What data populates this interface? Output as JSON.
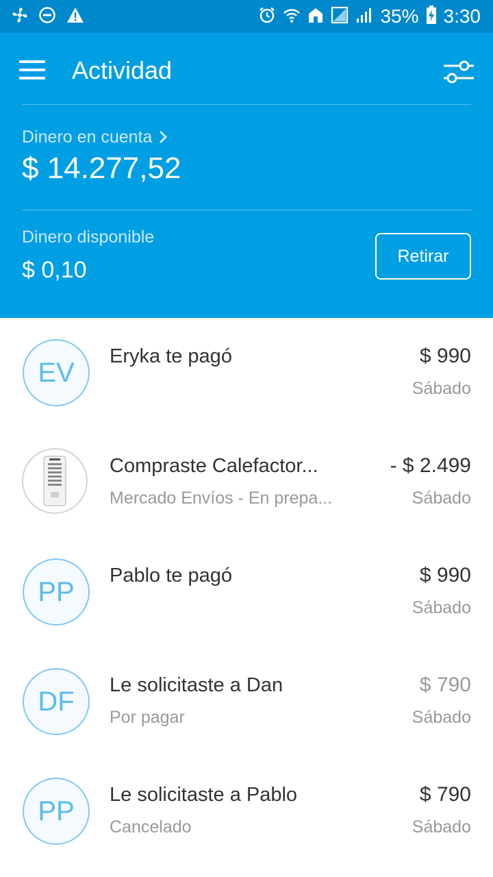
{
  "status_bar": {
    "battery": "35%",
    "time": "3:30"
  },
  "header": {
    "title": "Actividad",
    "balance_label": "Dinero en cuenta",
    "balance_amount": "$ 14.277,52",
    "available_label": "Dinero disponible",
    "available_amount": "$ 0,10",
    "withdraw_label": "Retirar"
  },
  "activities": [
    {
      "initials": "EV",
      "title": "Eryka te pagó",
      "subtitle": "",
      "amount": "$ 990",
      "date": "Sábado"
    },
    {
      "initials": "",
      "title": "Compraste Calefactor...",
      "subtitle": "Mercado Envíos - En prepa...",
      "amount": "- $ 2.499",
      "date": "Sábado"
    },
    {
      "initials": "PP",
      "title": "Pablo te pagó",
      "subtitle": "",
      "amount": "$ 990",
      "date": "Sábado"
    },
    {
      "initials": "DF",
      "title": "Le solicitaste a Dan",
      "subtitle": "Por pagar",
      "amount": "$ 790",
      "date": "Sábado"
    },
    {
      "initials": "PP",
      "title": "Le solicitaste a Pablo",
      "subtitle": "Cancelado",
      "amount": "$ 790",
      "date": "Sábado"
    }
  ],
  "colors": {
    "header_bg": "#009ee3",
    "status_bg": "#0088cc",
    "avatar_accent": "#5bbbea"
  }
}
